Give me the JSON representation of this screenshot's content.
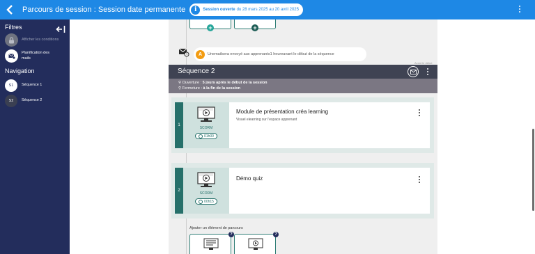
{
  "topbar": {
    "title": "Parcours de session : Session date permanente",
    "status_label": "Session ouverte",
    "status_dates": "du 28 mars 2025 au 20 avril 2025"
  },
  "sidebar": {
    "filters_heading": "Filtres",
    "filter_items": [
      {
        "label": "Afficher les conditions"
      },
      {
        "label_line1": "Planification des",
        "label_line2": "mails"
      }
    ],
    "navigation_heading": "Navigation",
    "nav_items": [
      {
        "badge": "S1",
        "label": "Séquence 1"
      },
      {
        "badge": "S2",
        "label": "Séquence 2"
      }
    ]
  },
  "mail_schedule": {
    "avatar_letter": "A",
    "text_prefix": "Un",
    "email_word": "email",
    "text_middle": "sera envoyé aux apprenants",
    "delay": "1 heure",
    "text_suffix": "avant le début de la séquence",
    "caption": "Avant le début"
  },
  "sequence": {
    "title": "Séquence 2",
    "opening_label": "Ouverture :",
    "opening_value": "5 jours après le début de la session",
    "closing_label": "Fermeture :",
    "closing_value": "à la fin de la session"
  },
  "modules": [
    {
      "number": "1",
      "type": "SCORM",
      "duration": "01h00",
      "title": "Module de présentation créa learning",
      "description": "Visuel elearning sur l'espace apprenant"
    },
    {
      "number": "2",
      "type": "SCORM",
      "duration": "00h15",
      "title": "Démo quiz",
      "description": ""
    }
  ],
  "add_element": {
    "label": "Ajouter un élément de parcours",
    "help_symbol": "?"
  },
  "add_buttons": {
    "symbol": "+"
  },
  "colors": {
    "topbar": "#1e88e5",
    "sidebar": "#232d5c",
    "module_accent": "#26706a",
    "sequence_header": "#3f4353",
    "avatar": "#f39c12"
  }
}
